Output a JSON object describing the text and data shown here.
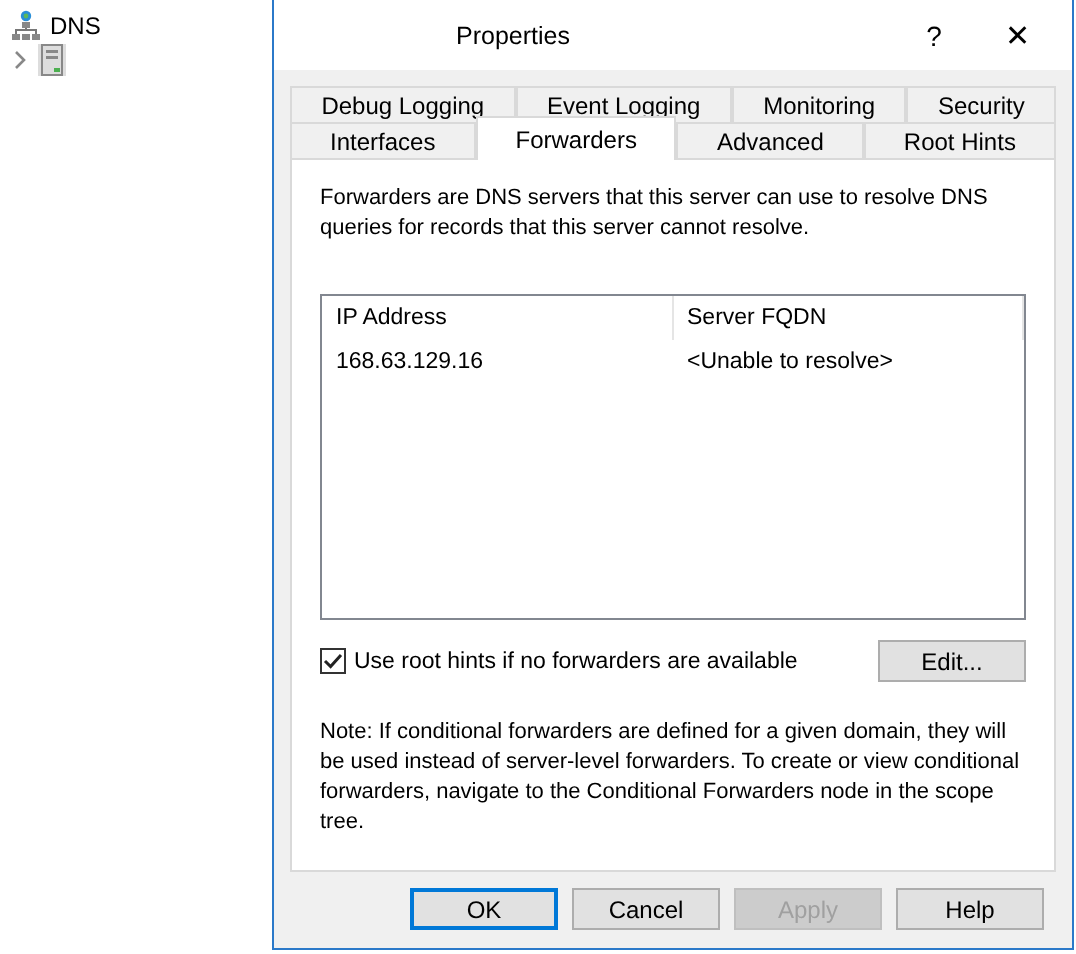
{
  "tree": {
    "items": [
      {
        "label": "DNS",
        "kind": "root"
      },
      {
        "kind": "server",
        "expanded": false
      }
    ]
  },
  "window": {
    "title": "Properties",
    "help": "?",
    "close": "✕"
  },
  "tab_rows": [
    [
      {
        "label": "Debug Logging",
        "selected": false
      },
      {
        "label": "Event Logging",
        "selected": false
      },
      {
        "label": "Monitoring",
        "selected": false
      },
      {
        "label": "Security",
        "selected": false
      }
    ],
    [
      {
        "label": "Interfaces",
        "selected": false
      },
      {
        "label": "Forwarders",
        "selected": true
      },
      {
        "label": "Advanced",
        "selected": false
      },
      {
        "label": "Root Hints",
        "selected": false
      }
    ]
  ],
  "description": "Forwarders are DNS servers that this server can use to resolve DNS queries for records that this server cannot resolve.",
  "table": {
    "columns": [
      "IP Address",
      "Server FQDN"
    ],
    "rows": [
      [
        "168.63.129.16",
        "<Unable to resolve>"
      ]
    ]
  },
  "use_root_hints": {
    "label": "Use root hints if no forwarders are available",
    "checked": true
  },
  "edit_button": "Edit...",
  "note": "Note: If conditional forwarders are defined for a given domain, they will be used instead of server-level forwarders.  To create or view conditional forwarders, navigate to the Conditional Forwarders node in the scope tree.",
  "buttons": [
    {
      "label": "OK",
      "default": true,
      "disabled": false
    },
    {
      "label": "Cancel",
      "default": false,
      "disabled": false
    },
    {
      "label": "Apply",
      "default": false,
      "disabled": true
    },
    {
      "label": "Help",
      "default": false,
      "disabled": false
    }
  ]
}
